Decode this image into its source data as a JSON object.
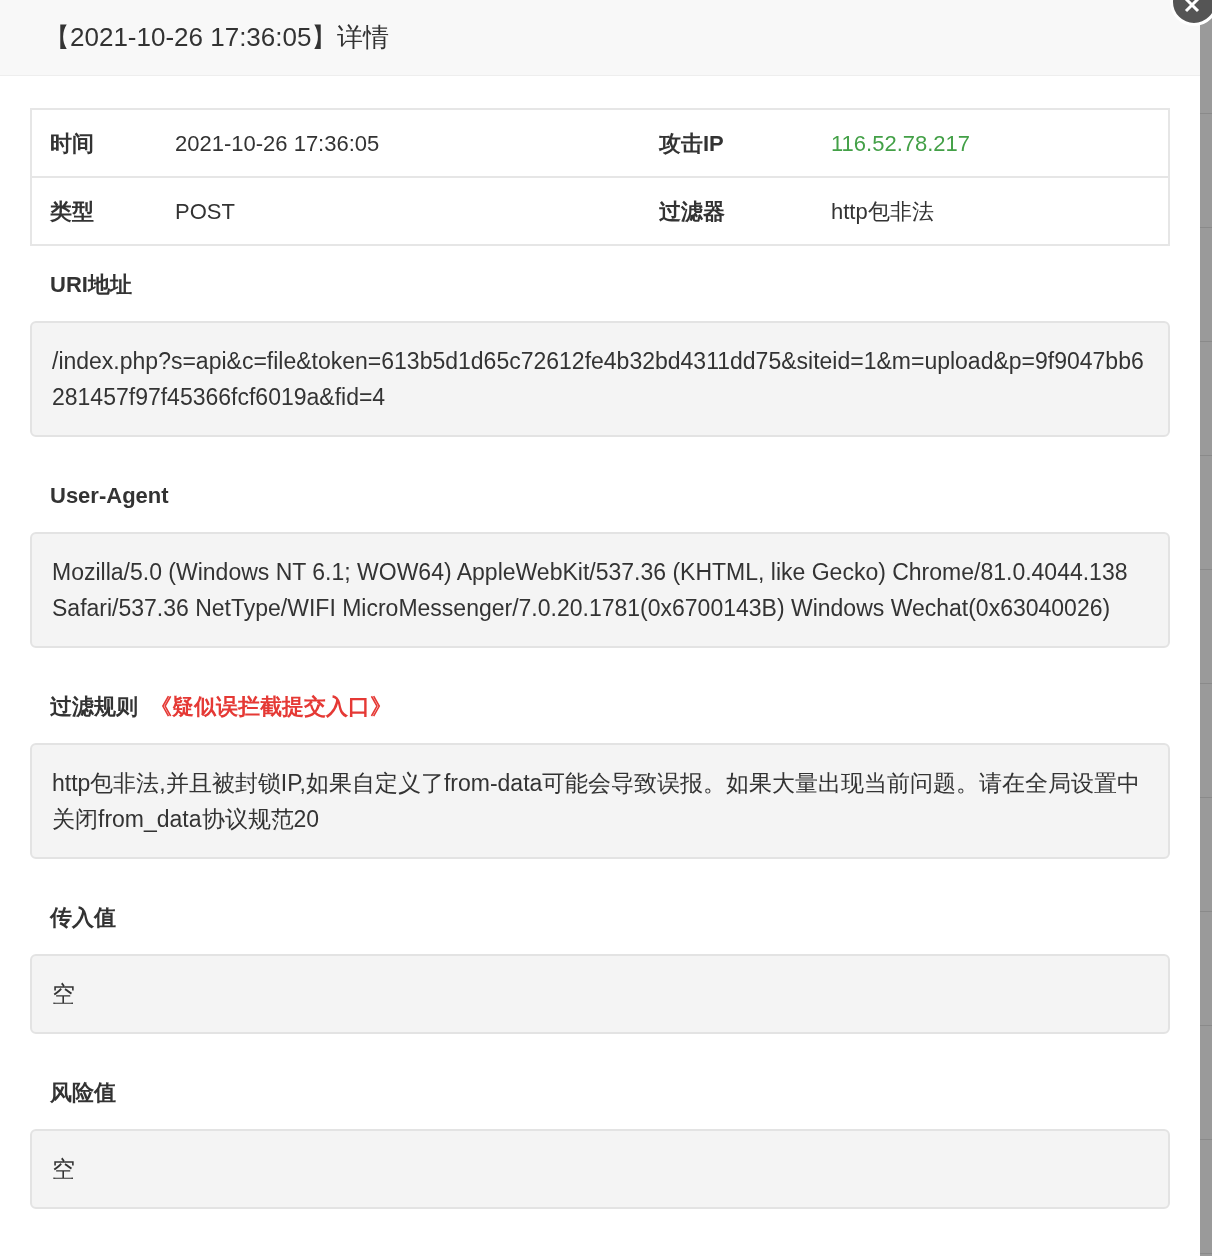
{
  "dialog": {
    "title": "【2021-10-26 17:36:05】详情"
  },
  "info_rows": [
    [
      {
        "label": "时间",
        "value": "2021-10-26 17:36:05",
        "highlight": false
      },
      {
        "label": "攻击IP",
        "value": "116.52.78.217",
        "highlight": true
      }
    ],
    [
      {
        "label": "类型",
        "value": "POST",
        "highlight": false
      },
      {
        "label": "过滤器",
        "value": "http包非法",
        "highlight": false
      }
    ]
  ],
  "sections": [
    {
      "heading": "URI地址",
      "content": "/index.php?s=api&c=file&token=613b5d1d65c72612fe4b32bd4311dd75&siteid=1&m=upload&p=9f9047bb6281457f97f45366fcf6019a&fid=4"
    },
    {
      "heading": "User-Agent",
      "content": "Mozilla/5.0 (Windows NT 6.1; WOW64) AppleWebKit/537.36 (KHTML, like Gecko) Chrome/81.0.4044.138 Safari/537.36 NetType/WIFI MicroMessenger/7.0.20.1781(0x6700143B) Windows Wechat(0x63040026)"
    },
    {
      "heading": "过滤规则",
      "note": "《疑似误拦截提交入口》",
      "content": "http包非法,并且被封锁IP,如果自定义了from-data可能会导致误报。如果大量出现当前问题。请在全局设置中关闭from_data协议规范20"
    },
    {
      "heading": "传入值",
      "content": "空"
    },
    {
      "heading": "风险值",
      "content": "空"
    }
  ]
}
